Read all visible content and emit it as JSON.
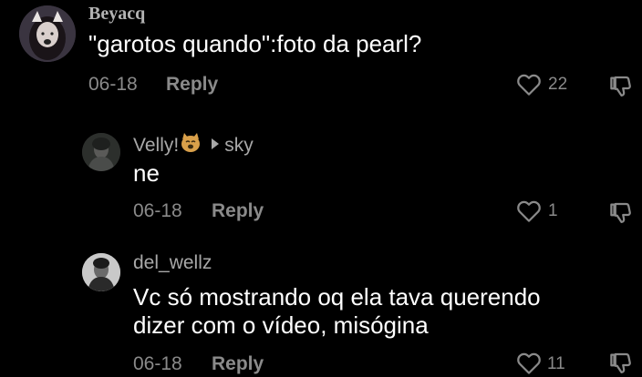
{
  "comments": [
    {
      "username": "Beyacq",
      "text": "\"garotos quando\":foto da pearl?",
      "date": "06-18",
      "reply_label": "Reply",
      "likes": "22"
    },
    {
      "username": "Velly!",
      "reply_to": "sky",
      "text": "ne",
      "date": "06-18",
      "reply_label": "Reply",
      "likes": "1"
    },
    {
      "username": "del_wellz",
      "text_line1": "Vc só mostrando oq ela tava querendo",
      "text_line2": "dizer com o vídeo, misógina",
      "date": "06-18",
      "reply_label": "Reply",
      "likes": "11"
    }
  ],
  "colors": {
    "background": "#000000",
    "username": "#a8a8a8",
    "secondary": "#8a8a8a",
    "text": "#ffffff"
  },
  "icons": [
    "heart-outline-icon",
    "dislike-icon",
    "reply-arrow-icon",
    "cat-emoji-icon"
  ]
}
